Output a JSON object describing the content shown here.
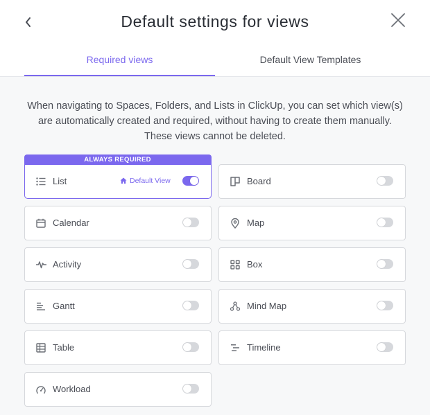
{
  "header": {
    "title": "Default settings for views",
    "back_icon": "chevron-left-icon",
    "close_icon": "close-icon"
  },
  "tabs": [
    {
      "label": "Required views",
      "active": true
    },
    {
      "label": "Default View Templates",
      "active": false
    }
  ],
  "description": "When navigating to Spaces, Folders, and Lists in ClickUp, you can set which view(s) are automatically created and required, without having to create them manually. These views cannot be deleted.",
  "required_card": {
    "banner": "ALWAYS REQUIRED",
    "label": "List",
    "icon": "list-icon",
    "default_view_label": "Default View",
    "default_view_icon": "home-icon",
    "enabled": true
  },
  "views": [
    {
      "label": "Board",
      "icon": "board-icon",
      "enabled": false
    },
    {
      "label": "Calendar",
      "icon": "calendar-icon",
      "enabled": false
    },
    {
      "label": "Map",
      "icon": "map-pin-icon",
      "enabled": false
    },
    {
      "label": "Activity",
      "icon": "activity-icon",
      "enabled": false
    },
    {
      "label": "Box",
      "icon": "box-icon",
      "enabled": false
    },
    {
      "label": "Gantt",
      "icon": "gantt-icon",
      "enabled": false
    },
    {
      "label": "Mind Map",
      "icon": "mind-map-icon",
      "enabled": false
    },
    {
      "label": "Table",
      "icon": "table-icon",
      "enabled": false
    },
    {
      "label": "Timeline",
      "icon": "timeline-icon",
      "enabled": false
    },
    {
      "label": "Workload",
      "icon": "workload-icon",
      "enabled": false
    }
  ],
  "colors": {
    "accent": "#7b68ee",
    "toggle_off": "#d6d8dc",
    "background": "#f7f8f9"
  }
}
